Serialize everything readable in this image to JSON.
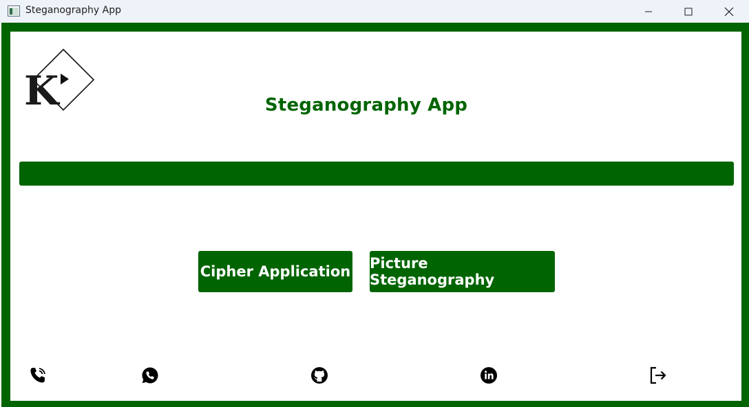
{
  "window": {
    "title": "Steganography App",
    "controls": [
      "minimize",
      "maximize",
      "close"
    ]
  },
  "header": {
    "logo_letter": "K",
    "title": "Steganography App"
  },
  "main": {
    "buttons": {
      "cipher_label": "Cipher Application",
      "picture_label": "Picture Steganography"
    }
  },
  "footer": {
    "icons": [
      "phone-icon",
      "whatsapp-icon",
      "github-icon",
      "linkedin-icon",
      "logout-icon"
    ]
  },
  "colors": {
    "brand_green": "#006400",
    "background": "#ffffff",
    "titlebar": "#eef2f9"
  }
}
